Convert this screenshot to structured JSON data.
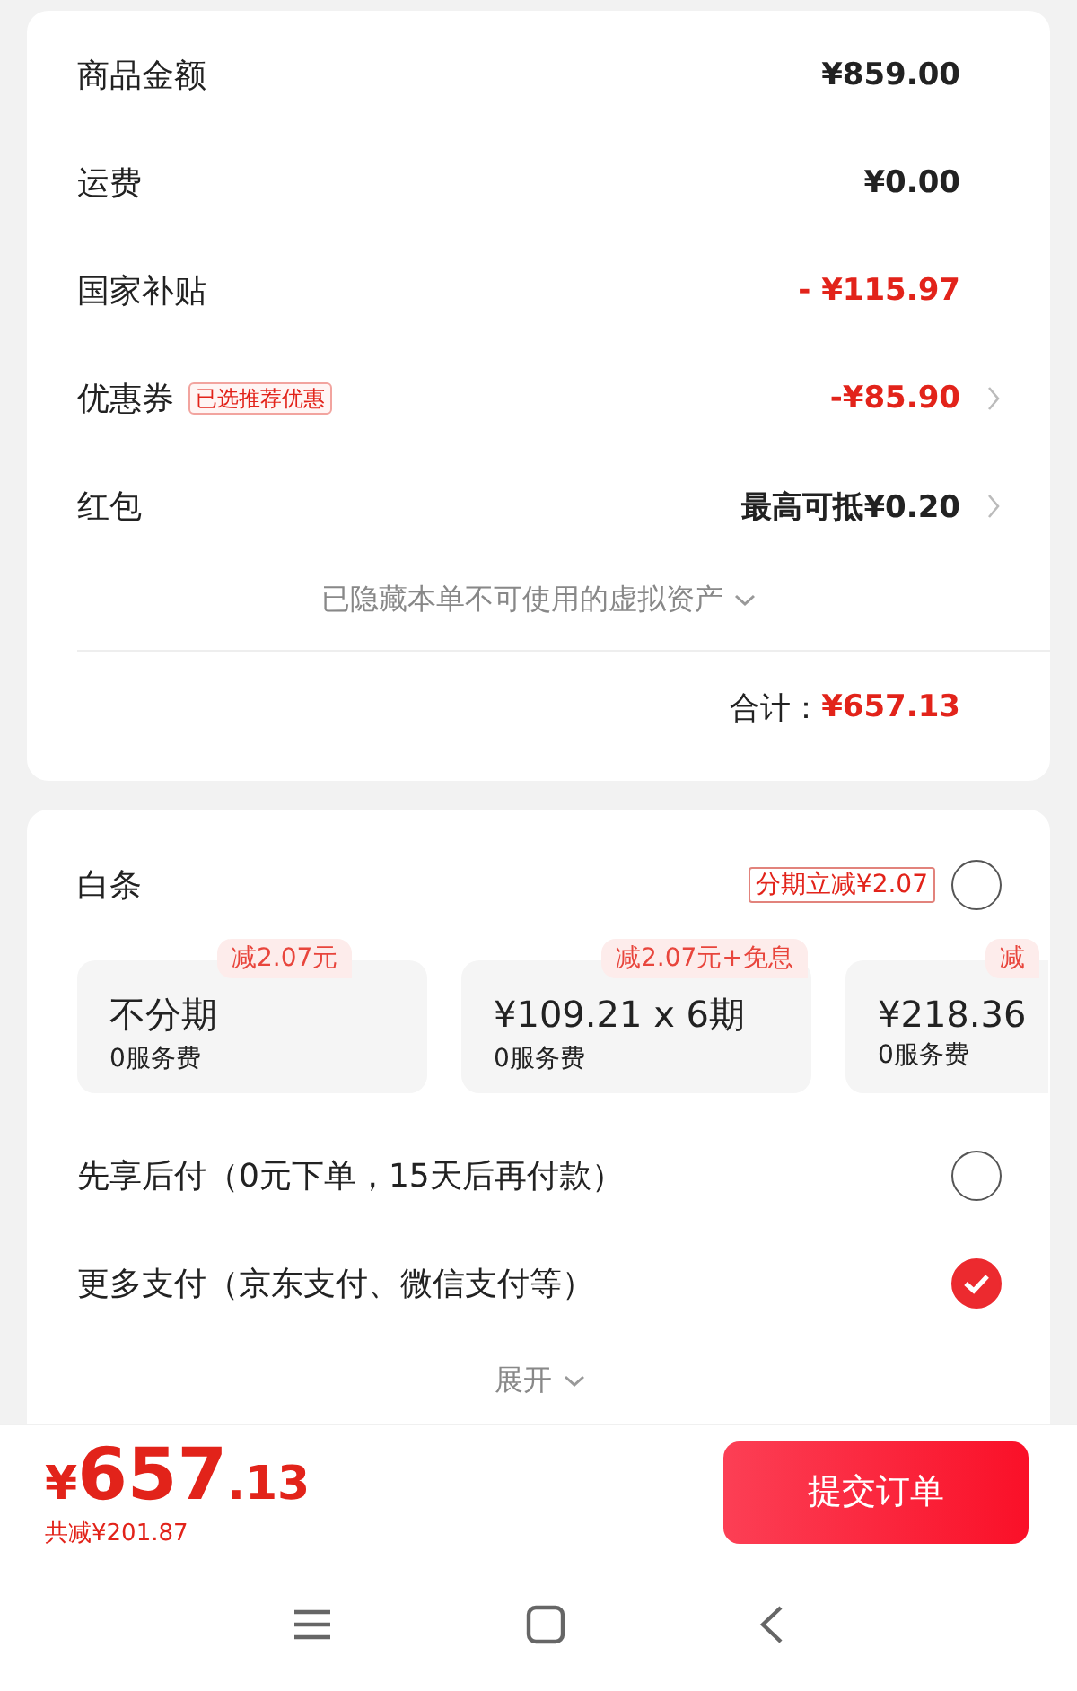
{
  "summary": {
    "rows": [
      {
        "label": "商品金额",
        "value": "¥859.00",
        "kind": "normal",
        "arrow": false
      },
      {
        "label": "运费",
        "value": "¥0.00",
        "kind": "normal",
        "arrow": false
      },
      {
        "label": "国家补贴",
        "value": "- ¥115.97",
        "kind": "discount",
        "arrow": false
      },
      {
        "label": "优惠券",
        "tag": "已选推荐优惠",
        "value": "-¥85.90",
        "kind": "discount",
        "arrow": true
      },
      {
        "label": "红包",
        "value": "最高可抵¥0.20",
        "kind": "normal",
        "arrow": true
      }
    ],
    "hidden_note": "已隐藏本单不可使用的虚拟资产",
    "total_label": "合计：",
    "total_value": "¥657.13"
  },
  "payment": {
    "baitiao": {
      "label": "白条",
      "promo": "分期立减¥2.07",
      "selected": false,
      "plans": [
        {
          "tag": "减2.07元",
          "title": "不分期",
          "fee": "0服务费"
        },
        {
          "tag": "减2.07元+免息",
          "title": "¥109.21 x 6期",
          "fee": "0服务费"
        },
        {
          "tag": "减",
          "title": "¥218.36",
          "fee": "0服务费"
        }
      ]
    },
    "options": [
      {
        "label": "先享后付（0元下单，15天后再付款）",
        "selected": false
      },
      {
        "label": "更多支付（京东支付、微信支付等）",
        "selected": true
      }
    ],
    "expand": "展开"
  },
  "footer": {
    "currency": "¥",
    "integer": "657",
    "decimal": ".13",
    "saved": "共减¥201.87",
    "submit": "提交订单"
  }
}
